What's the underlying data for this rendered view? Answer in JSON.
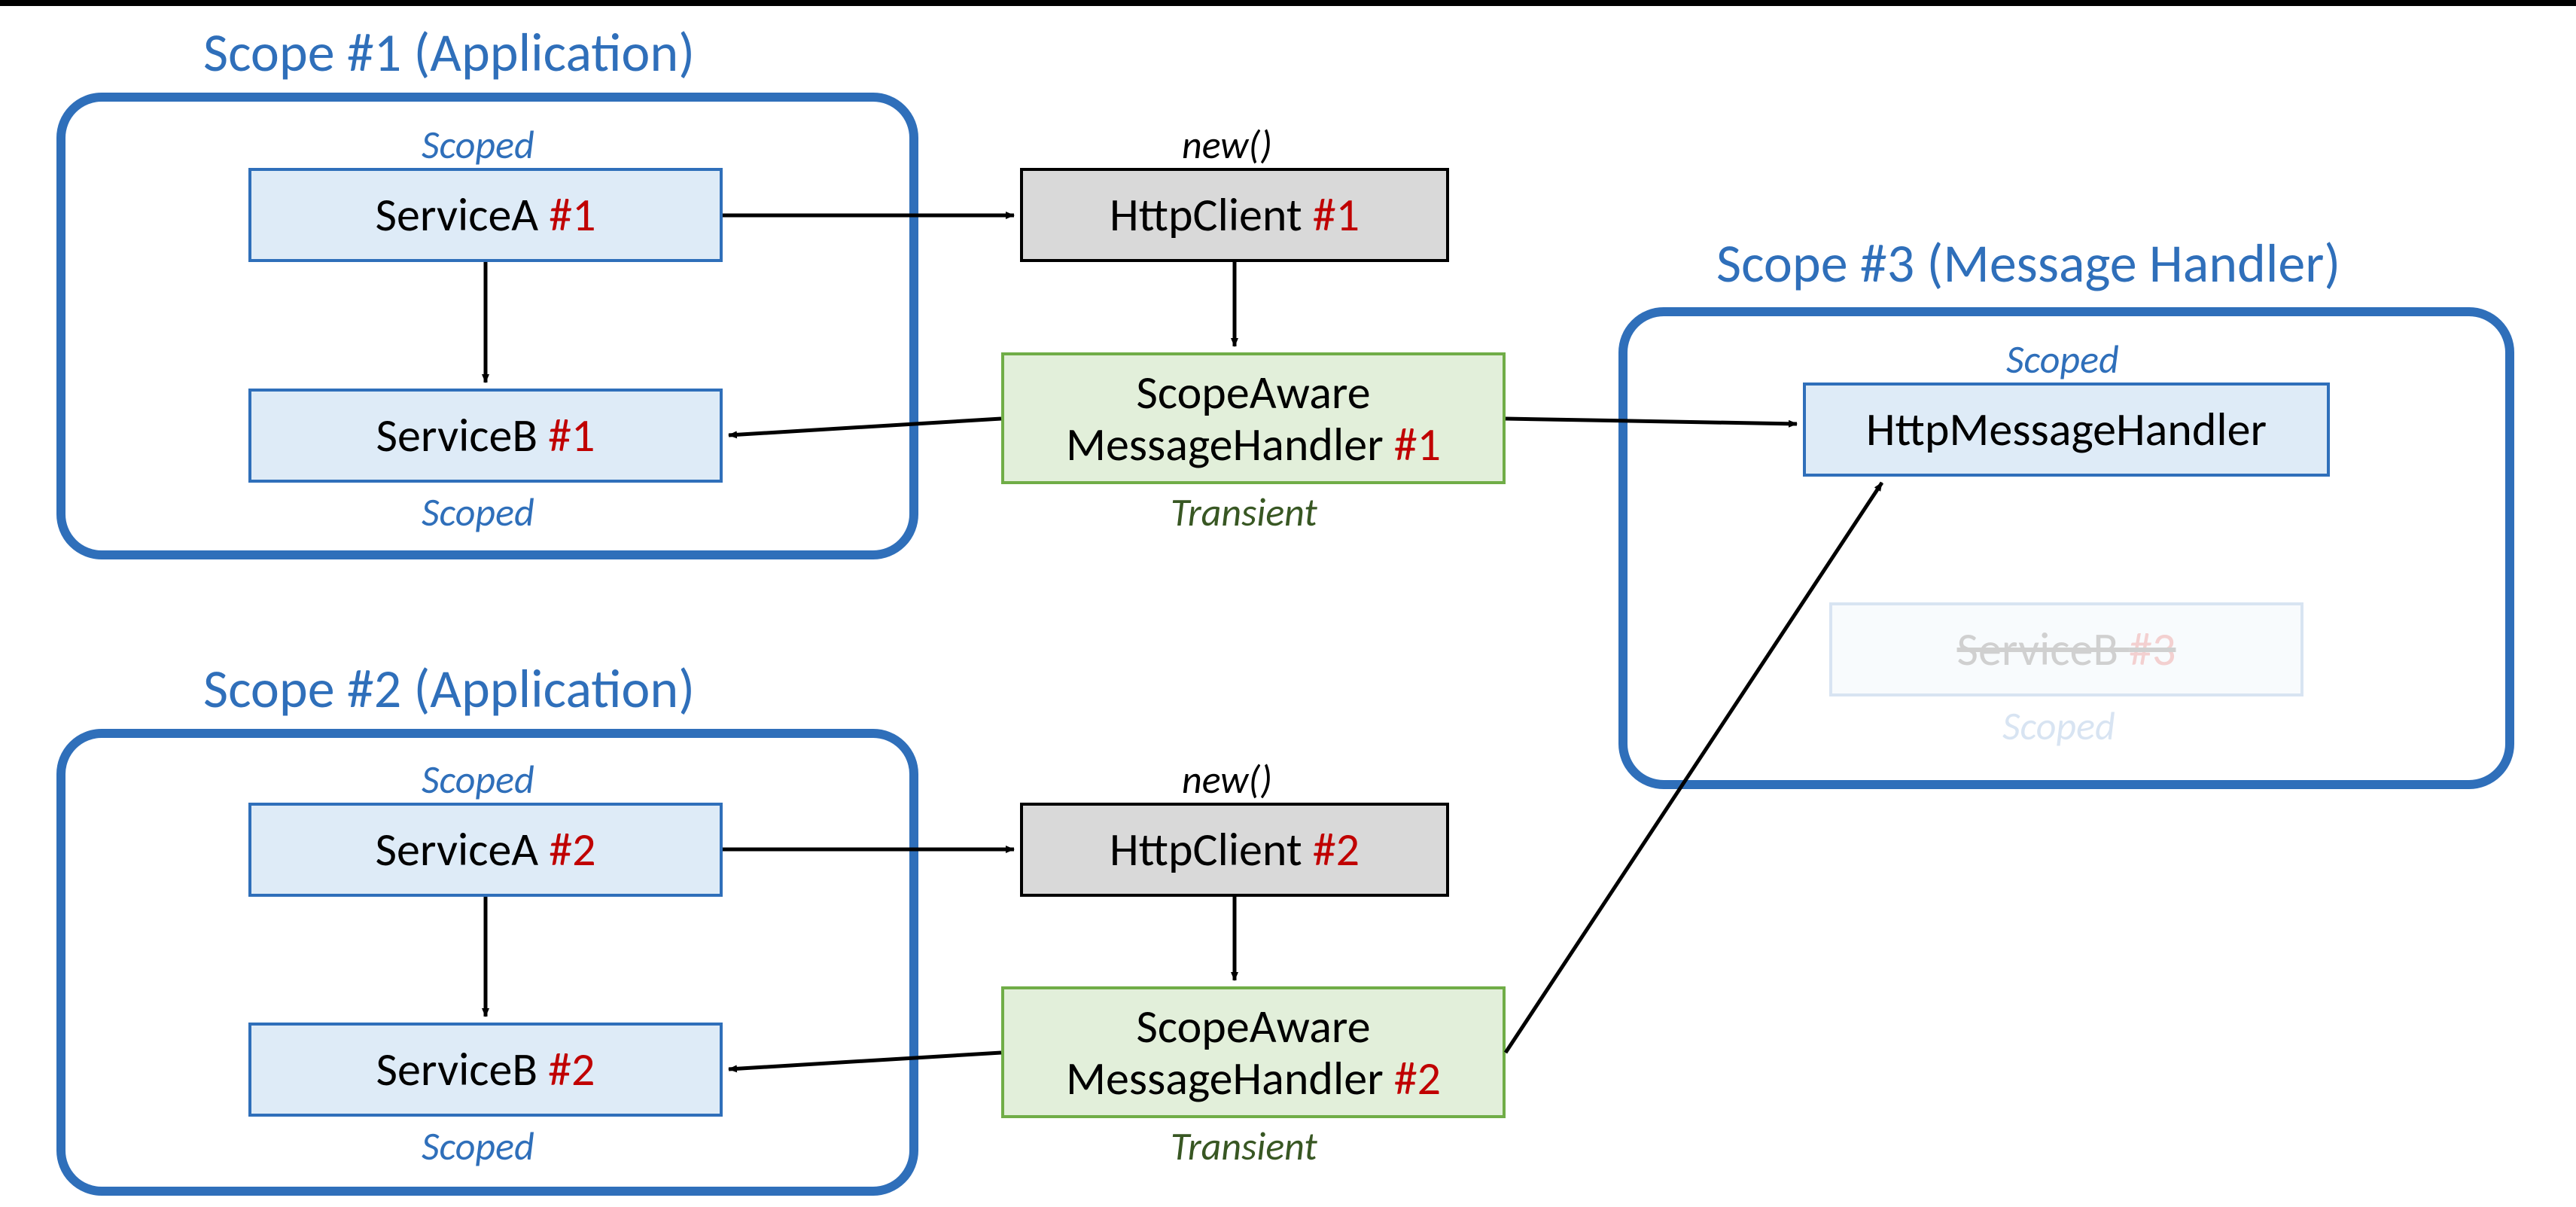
{
  "scope1": {
    "title": "Scope #1 (Application)",
    "serviceA": {
      "name": "ServiceA ",
      "instance": "#1",
      "lifestyle": "Scoped"
    },
    "serviceB": {
      "name": "ServiceB ",
      "instance": "#1",
      "lifestyle": "Scoped"
    },
    "httpClient": {
      "name": "HttpClient ",
      "instance": "#1",
      "creator": "new()"
    },
    "handler": {
      "line1": "ScopeAware",
      "line2a": "MessageHandler ",
      "line2b": "#1",
      "lifestyle": "Transient"
    }
  },
  "scope2": {
    "title": "Scope #2 (Application)",
    "serviceA": {
      "name": "ServiceA ",
      "instance": "#2",
      "lifestyle": "Scoped"
    },
    "serviceB": {
      "name": "ServiceB ",
      "instance": "#2",
      "lifestyle": "Scoped"
    },
    "httpClient": {
      "name": "HttpClient ",
      "instance": "#2",
      "creator": "new()"
    },
    "handler": {
      "line1": "ScopeAware",
      "line2a": "MessageHandler ",
      "line2b": "#2",
      "lifestyle": "Transient"
    }
  },
  "scope3": {
    "title": "Scope #3 (Message Handler)",
    "httpMsgHandler": {
      "name": "HttpMessageHandler",
      "lifestyle": "Scoped"
    },
    "serviceB": {
      "name": "ServiceB ",
      "instance": "#3",
      "lifestyle": "Scoped"
    }
  }
}
